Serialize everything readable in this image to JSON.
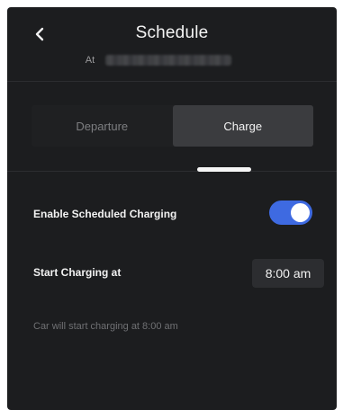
{
  "header": {
    "title": "Schedule",
    "at_label": "At",
    "back_icon": "chevron-left-icon"
  },
  "tabs": [
    {
      "label": "Departure",
      "active": false
    },
    {
      "label": "Charge",
      "active": true
    }
  ],
  "settings": {
    "enable_label": "Enable Scheduled Charging",
    "enabled": true,
    "start_label": "Start Charging at",
    "start_time": "8:00 am",
    "hint": "Car will start charging at 8:00 am"
  },
  "colors": {
    "background": "#1c1d1f",
    "accent": "#3e6ae1",
    "text": "#f2f2f2",
    "muted": "#7d7e81"
  }
}
